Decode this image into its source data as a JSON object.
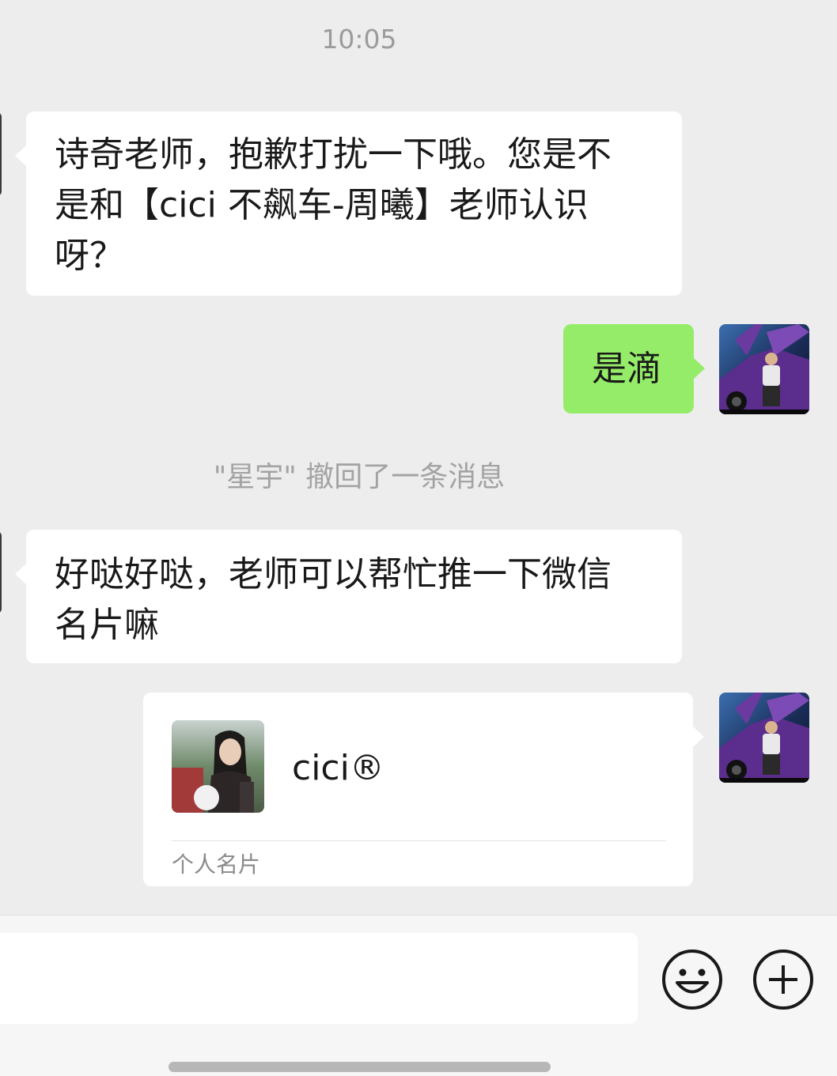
{
  "chat": {
    "timestamp": "10:05",
    "messages": [
      {
        "direction": "incoming",
        "text": "诗奇老师，抱歉打扰一下哦。您是不\n是和【cici 不飙车-周曦】老师认识\n呀？"
      },
      {
        "direction": "outgoing",
        "text": "是滴"
      },
      {
        "direction": "incoming",
        "text": "好哒好哒，老师可以帮忙推一下微信\n名片嘛"
      }
    ],
    "system_notice": "\"星宇\" 撤回了一条消息",
    "contact_card": {
      "name": "cici®",
      "type_label": "个人名片"
    }
  },
  "input_bar": {
    "input_value": "",
    "emoji_icon": "smiley-face-icon",
    "more_icon": "plus-circle-icon"
  },
  "colors": {
    "background": "#ededed",
    "incoming_bubble": "#ffffff",
    "outgoing_bubble": "#95ec69",
    "system_text": "#a3a3a3"
  }
}
